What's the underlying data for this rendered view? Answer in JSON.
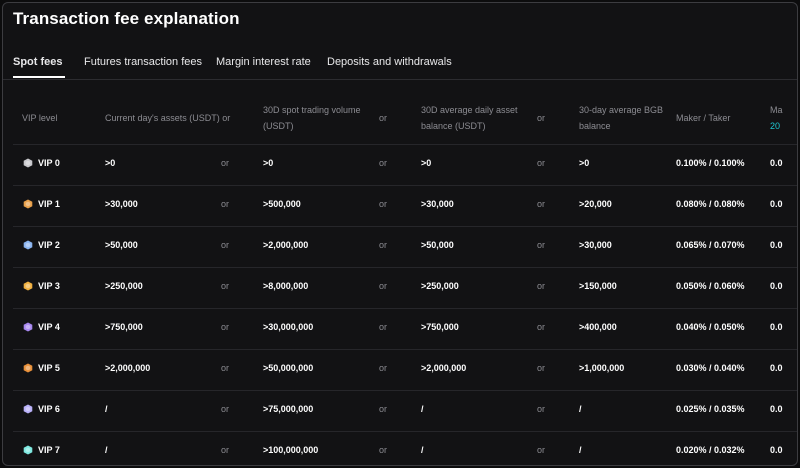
{
  "page": {
    "title": "Transaction fee explanation"
  },
  "tabs": [
    {
      "label": "Spot fees",
      "active": true
    },
    {
      "label": "Futures transaction fees",
      "active": false
    },
    {
      "label": "Margin interest rate",
      "active": false
    },
    {
      "label": "Deposits and withdrawals",
      "active": false
    }
  ],
  "table": {
    "headers": {
      "vip_level": "VIP level",
      "assets": "Current day's assets (USDT) or",
      "volume_line1": "30D spot trading volume",
      "volume_line2": "(USDT)",
      "avg_balance_line1": "30D average daily asset",
      "avg_balance_line2": "balance (USDT)",
      "bgb_line1": "30-day average BGB",
      "bgb_line2": "balance",
      "maker_taker": "Maker / Taker",
      "partial_line1": "Ma",
      "partial_line2": "20",
      "or": "or"
    },
    "rows": [
      {
        "vip": "VIP 0",
        "icon_color": "#c8c8cc",
        "assets": ">0",
        "volume": ">0",
        "avg_balance": ">0",
        "bgb": ">0",
        "maker_taker": "0.100% / 0.100%",
        "partial": "0.0"
      },
      {
        "vip": "VIP 1",
        "icon_color": "#e8a04a",
        "assets": ">30,000",
        "volume": ">500,000",
        "avg_balance": ">30,000",
        "bgb": ">20,000",
        "maker_taker": "0.080% / 0.080%",
        "partial": "0.0"
      },
      {
        "vip": "VIP 2",
        "icon_color": "#8ab4f0",
        "assets": ">50,000",
        "volume": ">2,000,000",
        "avg_balance": ">50,000",
        "bgb": ">30,000",
        "maker_taker": "0.065% / 0.070%",
        "partial": "0.0"
      },
      {
        "vip": "VIP 3",
        "icon_color": "#f0b040",
        "assets": ">250,000",
        "volume": ">8,000,000",
        "avg_balance": ">250,000",
        "bgb": ">150,000",
        "maker_taker": "0.050% / 0.060%",
        "partial": "0.0"
      },
      {
        "vip": "VIP 4",
        "icon_color": "#a888f0",
        "assets": ">750,000",
        "volume": ">30,000,000",
        "avg_balance": ">750,000",
        "bgb": ">400,000",
        "maker_taker": "0.040% / 0.050%",
        "partial": "0.0"
      },
      {
        "vip": "VIP 5",
        "icon_color": "#e8903a",
        "assets": ">2,000,000",
        "volume": ">50,000,000",
        "avg_balance": ">2,000,000",
        "bgb": ">1,000,000",
        "maker_taker": "0.030% / 0.040%",
        "partial": "0.0"
      },
      {
        "vip": "VIP 6",
        "icon_color": "#b8b0f8",
        "assets": "/",
        "volume": ">75,000,000",
        "avg_balance": "/",
        "bgb": "/",
        "maker_taker": "0.025% / 0.035%",
        "partial": "0.0"
      },
      {
        "vip": "VIP 7",
        "icon_color": "#7ee8e0",
        "assets": "/",
        "volume": ">100,000,000",
        "avg_balance": "/",
        "bgb": "/",
        "maker_taker": "0.020% / 0.032%",
        "partial": "0.0"
      }
    ]
  }
}
